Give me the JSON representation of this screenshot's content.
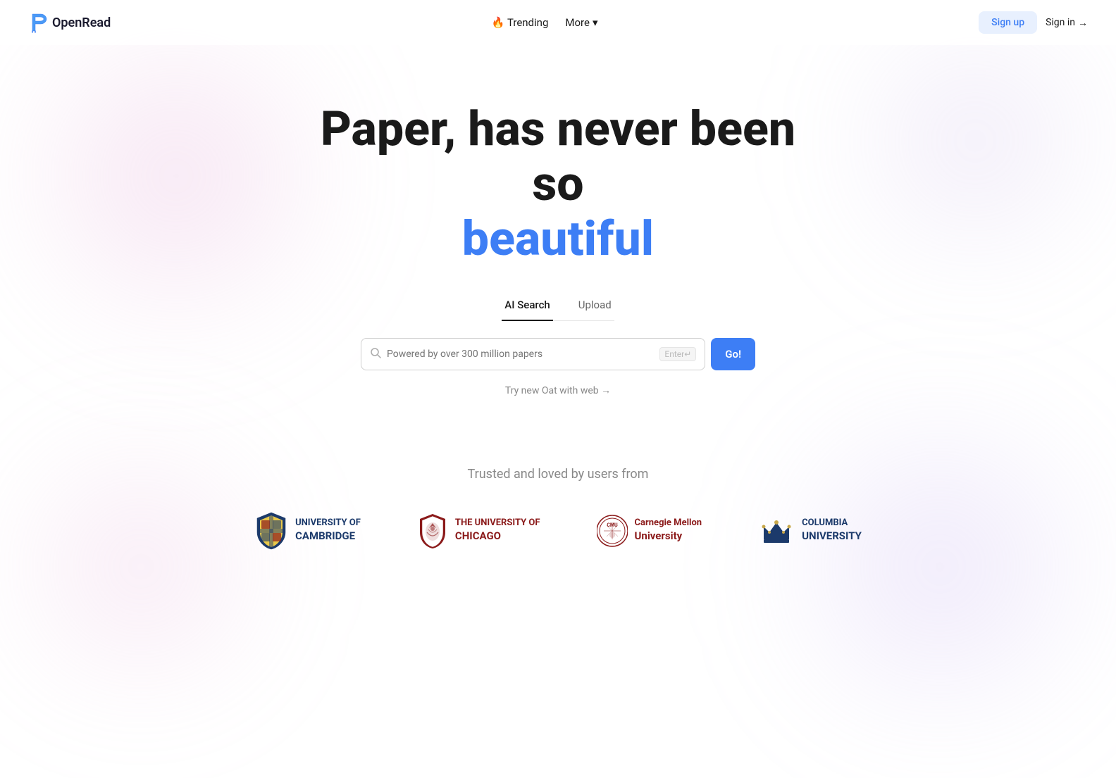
{
  "nav": {
    "logo_text": "OpenRead",
    "trending_label": "🔥 Trending",
    "more_label": "More",
    "more_chevron": "▾",
    "signup_label": "Sign up",
    "signin_label": "Sign in",
    "signin_arrow": "→"
  },
  "hero": {
    "line1": "Paper, has never been",
    "line2": "so",
    "line3": "beautiful"
  },
  "tabs": [
    {
      "id": "ai-search",
      "label": "AI Search",
      "active": true
    },
    {
      "id": "upload",
      "label": "Upload",
      "active": false
    }
  ],
  "search": {
    "placeholder": "Powered by over 300 million papers",
    "enter_hint": "Enter↵",
    "go_button": "Go!"
  },
  "oat_link": "Try new Oat with web →",
  "trusted": {
    "title": "Trusted and loved by users from",
    "universities": [
      {
        "id": "cambridge",
        "line1": "UNIVERSITY OF",
        "line2": "CAMBRIDGE"
      },
      {
        "id": "chicago",
        "line1": "THE UNIVERSITY OF",
        "line2": "CHICAGO"
      },
      {
        "id": "cmu",
        "line1": "Carnegie Mellon",
        "line2": "University"
      },
      {
        "id": "columbia",
        "line1": "COLUMBIA",
        "line2": "UNIVERSITY"
      }
    ]
  }
}
